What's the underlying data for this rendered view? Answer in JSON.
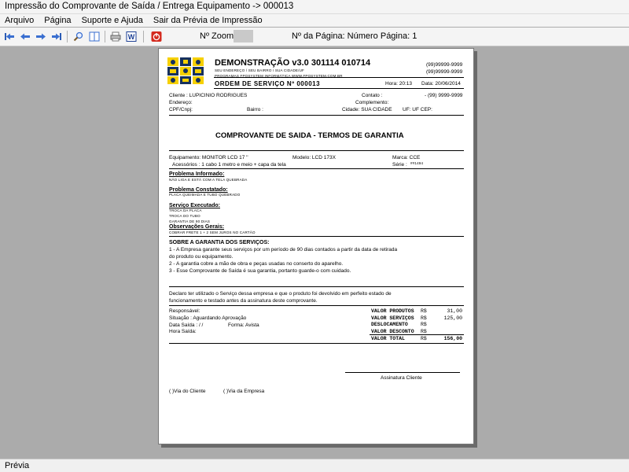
{
  "window": {
    "title": "Impressão do Comprovante de Saída / Entrega Equipamento -> 000013"
  },
  "menu": [
    "Arquivo",
    "Página",
    "Suporte e Ajuda",
    "Sair da Prévia de Impressão"
  ],
  "toolbar": {
    "zoom_label": "Nº Zoom",
    "page_label": "Nº da Página: Número Página: 1",
    "icons": [
      "first-page",
      "previous-page",
      "next-page",
      "last-page",
      "zoom",
      "page-view",
      "print",
      "word-export",
      "close"
    ]
  },
  "status": {
    "text": "Prévia"
  },
  "doc": {
    "company": "DEMONSTRAÇÃO v3.0 301114 010714",
    "address_line": "SEU ENDEREÇO / SEU BAIRRO / SUA CIDADE/UF",
    "program_line": "PROGRAMAS FPOSYSTEM INFORMÁTICA  WWW.FPOSYSTEM.COM.BR",
    "phone1": "(99)99999-9999",
    "phone2": "(99)99999-9999",
    "order": "ORDEM DE SERVIÇO Nº 000013",
    "hora": "Hora: 20:13",
    "data": "Data: 20/06/2014",
    "cliente": "Cliente   : LUPICINIO RODRIGUES",
    "contato": "Contato :",
    "cliente_phone": "- (99) 9999-9999",
    "endereco": "Endereço:",
    "complemento": "Complemento:",
    "cpf": "CPF/Cnpj:",
    "bairro": "Bairro :",
    "cidade": "Cidade: SUA CIDADE",
    "uf": "UF: UF  CEP:",
    "heading": "COMPROVANTE DE SAIDA - TERMOS DE GARANTIA",
    "equipamento": "Equipamento: MONITOR LCD 17 ''",
    "modelo": "Modelo: LCD 173X",
    "marca": "Marca: CCE",
    "acessorios": "Acessórios : 1 cabo 1 metro e meio + capa da tela",
    "serie_label": "Série :",
    "serie_value": "##1494",
    "prob_inf_label": "Problema Informado:",
    "prob_inf": "NÃO LIGA E ESTÁ COM A TELA QUEBRADA",
    "prob_const_label": "Problema Constatado:",
    "prob_const": "PLACA QUEIMADA E TUBO QUEBRADO",
    "serv_label": "Serviço Executado:",
    "serv_lines": [
      "TROCA DA PLACA",
      "TROCA DO TUBO",
      "GARANTIA DE 90 DIAS"
    ],
    "obs_label": "Observações Gerais:",
    "obs": "COBRAR FRETE 1 + 2 SEM JUROS NO CARTÃO",
    "garantia_title": "SOBRE A GARANTIA DOS SERVIÇOS:",
    "garantia_lines": [
      "1 - A Empresa garante seus serviços por um período de 90 dias contados a partir da data de retirada",
      "do produto ou equipamento.",
      "2 - A garantia cobre a mão de obra e peças usadas no conserto do aparelho.",
      "3 - Esse Comprovante de Saída é sua garantia, portanto guarde-o com cuidado."
    ],
    "declaro_lines": [
      "Declaro ter utilizado o Serviço dessa empresa e que o produto foi devolvido em perfeito estado de",
      "funcionamento e testado antes da assinatura deste comprovante."
    ],
    "responsavel": "Responsável:",
    "situacao": "Situação : Aguardando Aprovação",
    "data_saida": "Data Saída :   / /",
    "forma": "Forma: Avista",
    "hora_saida": "Hora Saída:",
    "totals": [
      {
        "label": "VALOR PRODUTOS",
        "cur": "R$",
        "value": "31,00"
      },
      {
        "label": "VALOR SERVIÇOS",
        "cur": "R$",
        "value": "125,00"
      },
      {
        "label": "DESLOCAMENTO",
        "cur": "R$",
        "value": ""
      },
      {
        "label": "VALOR DESCONTO",
        "cur": "R$",
        "value": ""
      },
      {
        "label": "VALOR TOTAL",
        "cur": "R$",
        "value": "156,00"
      }
    ],
    "assinatura": "Assinatura Cliente",
    "via_cliente": "(  )Via do Cliente",
    "via_empresa": "(  )Via da Empresa"
  }
}
